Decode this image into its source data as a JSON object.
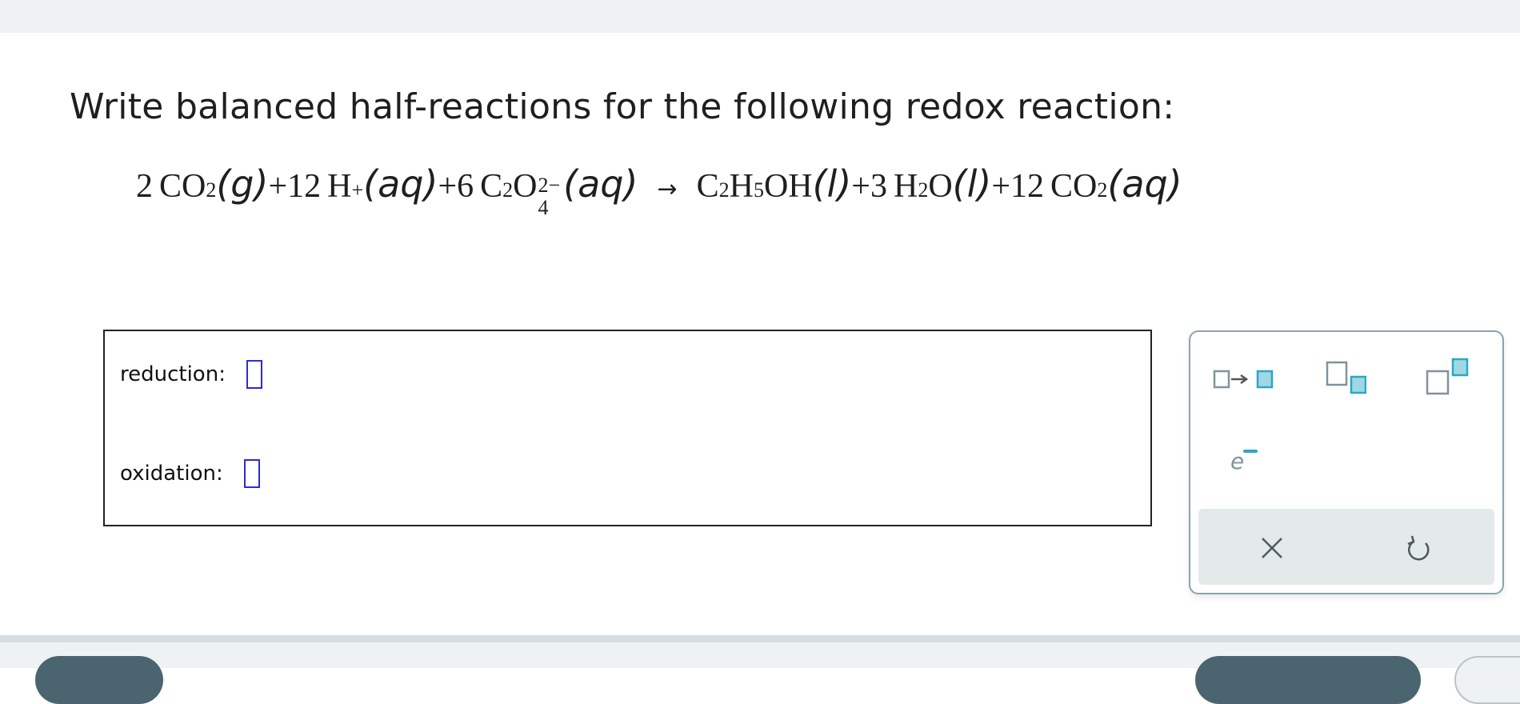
{
  "question": {
    "prompt": "Write balanced half-reactions for the following redox reaction:",
    "equation": {
      "c1": "2",
      "co": "CO",
      "sub2": "2",
      "g": "(g)",
      "plus": "+",
      "c2": "12",
      "h": "H",
      "hplus": "+",
      "aq": "(aq)",
      "c3": "6",
      "c": "C",
      "o": "O",
      "sub4": "4",
      "charge": "2−",
      "arrow": "→",
      "h5": "5",
      "oh": "OH",
      "l": "(l)",
      "c4": "3",
      "c5": "12"
    }
  },
  "answer": {
    "reduction_label": "reduction:",
    "oxidation_label": "oxidation:"
  },
  "palette": {
    "electron_label": "e",
    "tools": [
      "arrow-template-icon",
      "subscript-template-icon",
      "superscript-template-icon",
      "electron-icon",
      "clear-icon",
      "undo-icon"
    ],
    "accent_color": "#2aa8c4"
  }
}
